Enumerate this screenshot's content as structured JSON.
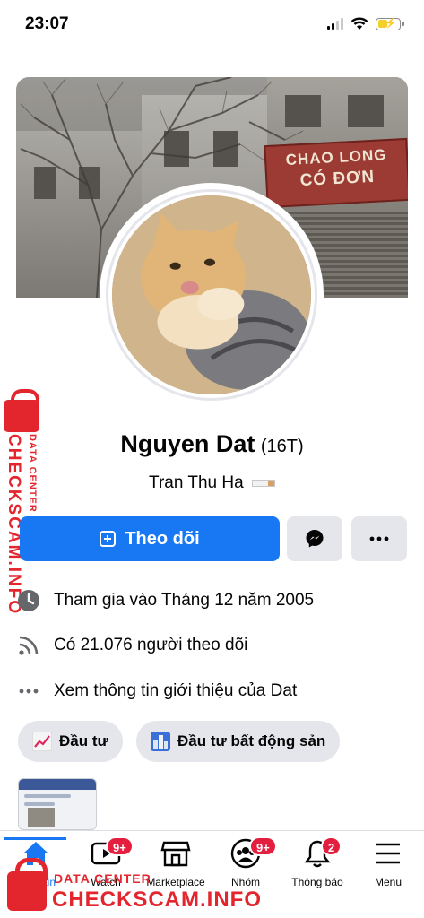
{
  "status_bar": {
    "time": "23:07"
  },
  "cover": {
    "sign_line1": "CHAO LONG",
    "sign_line2": "CÓ ĐƠN"
  },
  "profile": {
    "name": "Nguyen Dat",
    "tag": "(16T)",
    "subtitle": "Tran Thu Ha"
  },
  "actions": {
    "follow_label": "Theo dõi"
  },
  "info": {
    "joined": "Tham gia vào Tháng 12 năm 2005",
    "followers": "Có 21.076 người theo dõi",
    "about": "Xem thông tin giới thiệu của Dat"
  },
  "chips": [
    {
      "label": "Đầu tư"
    },
    {
      "label": "Đầu tư bất động sản"
    }
  ],
  "nav": {
    "items": [
      {
        "label": "Bảng tin",
        "icon": "home-icon"
      },
      {
        "label": "Watch",
        "icon": "watch-icon",
        "badge": "9+"
      },
      {
        "label": "Marketplace",
        "icon": "marketplace-icon"
      },
      {
        "label": "Nhóm",
        "icon": "groups-icon",
        "badge": "9+"
      },
      {
        "label": "Thông báo",
        "icon": "bell-icon",
        "badge": "2"
      },
      {
        "label": "Menu",
        "icon": "menu-icon"
      }
    ]
  },
  "watermark": {
    "small": "DATA CENTER",
    "big": "CHECKSCAM.INFO"
  },
  "colors": {
    "accent": "#1877f2",
    "badge": "#e41e3f",
    "watermark": "#e3262e"
  }
}
